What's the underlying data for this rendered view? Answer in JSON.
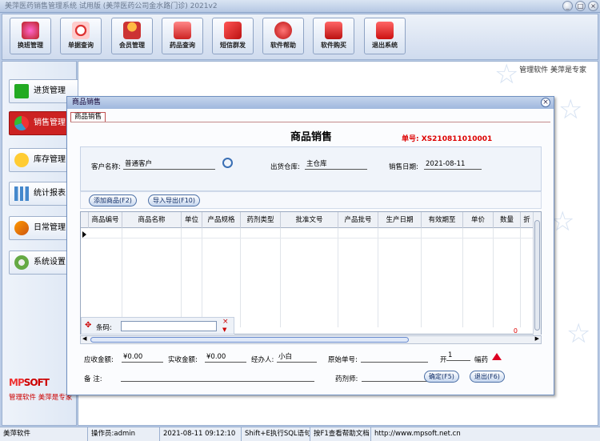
{
  "window": {
    "title": "美萍医药销售管理系统 试用版 (美萍医药公司金水路门诊) 2021v2",
    "controls": [
      "_",
      "□",
      "×"
    ]
  },
  "toolbar": {
    "items": [
      {
        "label": "换班管理",
        "icon": "shift-change-icon"
      },
      {
        "label": "单据查询",
        "icon": "magnifier-icon"
      },
      {
        "label": "会员管理",
        "icon": "member-icon"
      },
      {
        "label": "药品查询",
        "icon": "pill-box-icon"
      },
      {
        "label": "短信群发",
        "icon": "envelope-icon"
      },
      {
        "label": "软件帮助",
        "icon": "help-icon"
      },
      {
        "label": "软件购买",
        "icon": "yen-icon"
      },
      {
        "label": "退出系统",
        "icon": "power-icon"
      }
    ]
  },
  "sidebar": {
    "items": [
      {
        "label": "进货管理",
        "icon": "plus-icon"
      },
      {
        "label": "销售管理",
        "icon": "pie-icon"
      },
      {
        "label": "库存管理",
        "icon": "star-icon"
      },
      {
        "label": "统计报表",
        "icon": "bar-chart-icon"
      },
      {
        "label": "日常管理",
        "icon": "brush-icon"
      },
      {
        "label": "系统设置",
        "icon": "gear-icon"
      }
    ],
    "brand_mp": "MP",
    "brand_soft": "SOFT",
    "slogan": "管理软件  美萍是专家"
  },
  "main": {
    "slogan": "管理软件  美萍是专家"
  },
  "dialog": {
    "title": "商品销售",
    "tab": "商品销售",
    "form_title": "商品销售",
    "doc_no_label": "单号:",
    "doc_no": "XS210811010001",
    "customer_label": "客户名称:",
    "customer": "普通客户",
    "warehouse_label": "出货仓库:",
    "warehouse": "主仓库",
    "date_label": "销售日期:",
    "date": "2021-08-11",
    "add_btn": "添加商品(F2)",
    "io_btn": "导入导出(F10)",
    "columns": [
      "商品编号",
      "商品名称",
      "单位",
      "产品规格",
      "药剂类型",
      "批准文号",
      "产品批号",
      "生产日期",
      "有效期至",
      "单价",
      "数量",
      "折"
    ],
    "barcode_label": "条码:",
    "total_qty": "0",
    "receivable_label": "应收金额:",
    "receivable": "¥0.00",
    "received_label": "实收金额:",
    "received": "¥0.00",
    "handler_label": "经办人:",
    "handler": "小白",
    "orig_no_label": "原始单号:",
    "open_label": "开",
    "open_count": "1",
    "open_suffix": "幅药",
    "remark_label": "备   注:",
    "pharmacist_label": "药剂师:",
    "confirm_btn": "确定(F5)",
    "exit_btn": "退出(F6)"
  },
  "status": {
    "app": "美萍软件",
    "operator": "操作员:admin",
    "time": "2021-08-11 09:12:10",
    "sql": "Shift+E执行SQL语句",
    "help": "按F1查看帮助文档",
    "url": "http://www.mpsoft.net.cn"
  }
}
